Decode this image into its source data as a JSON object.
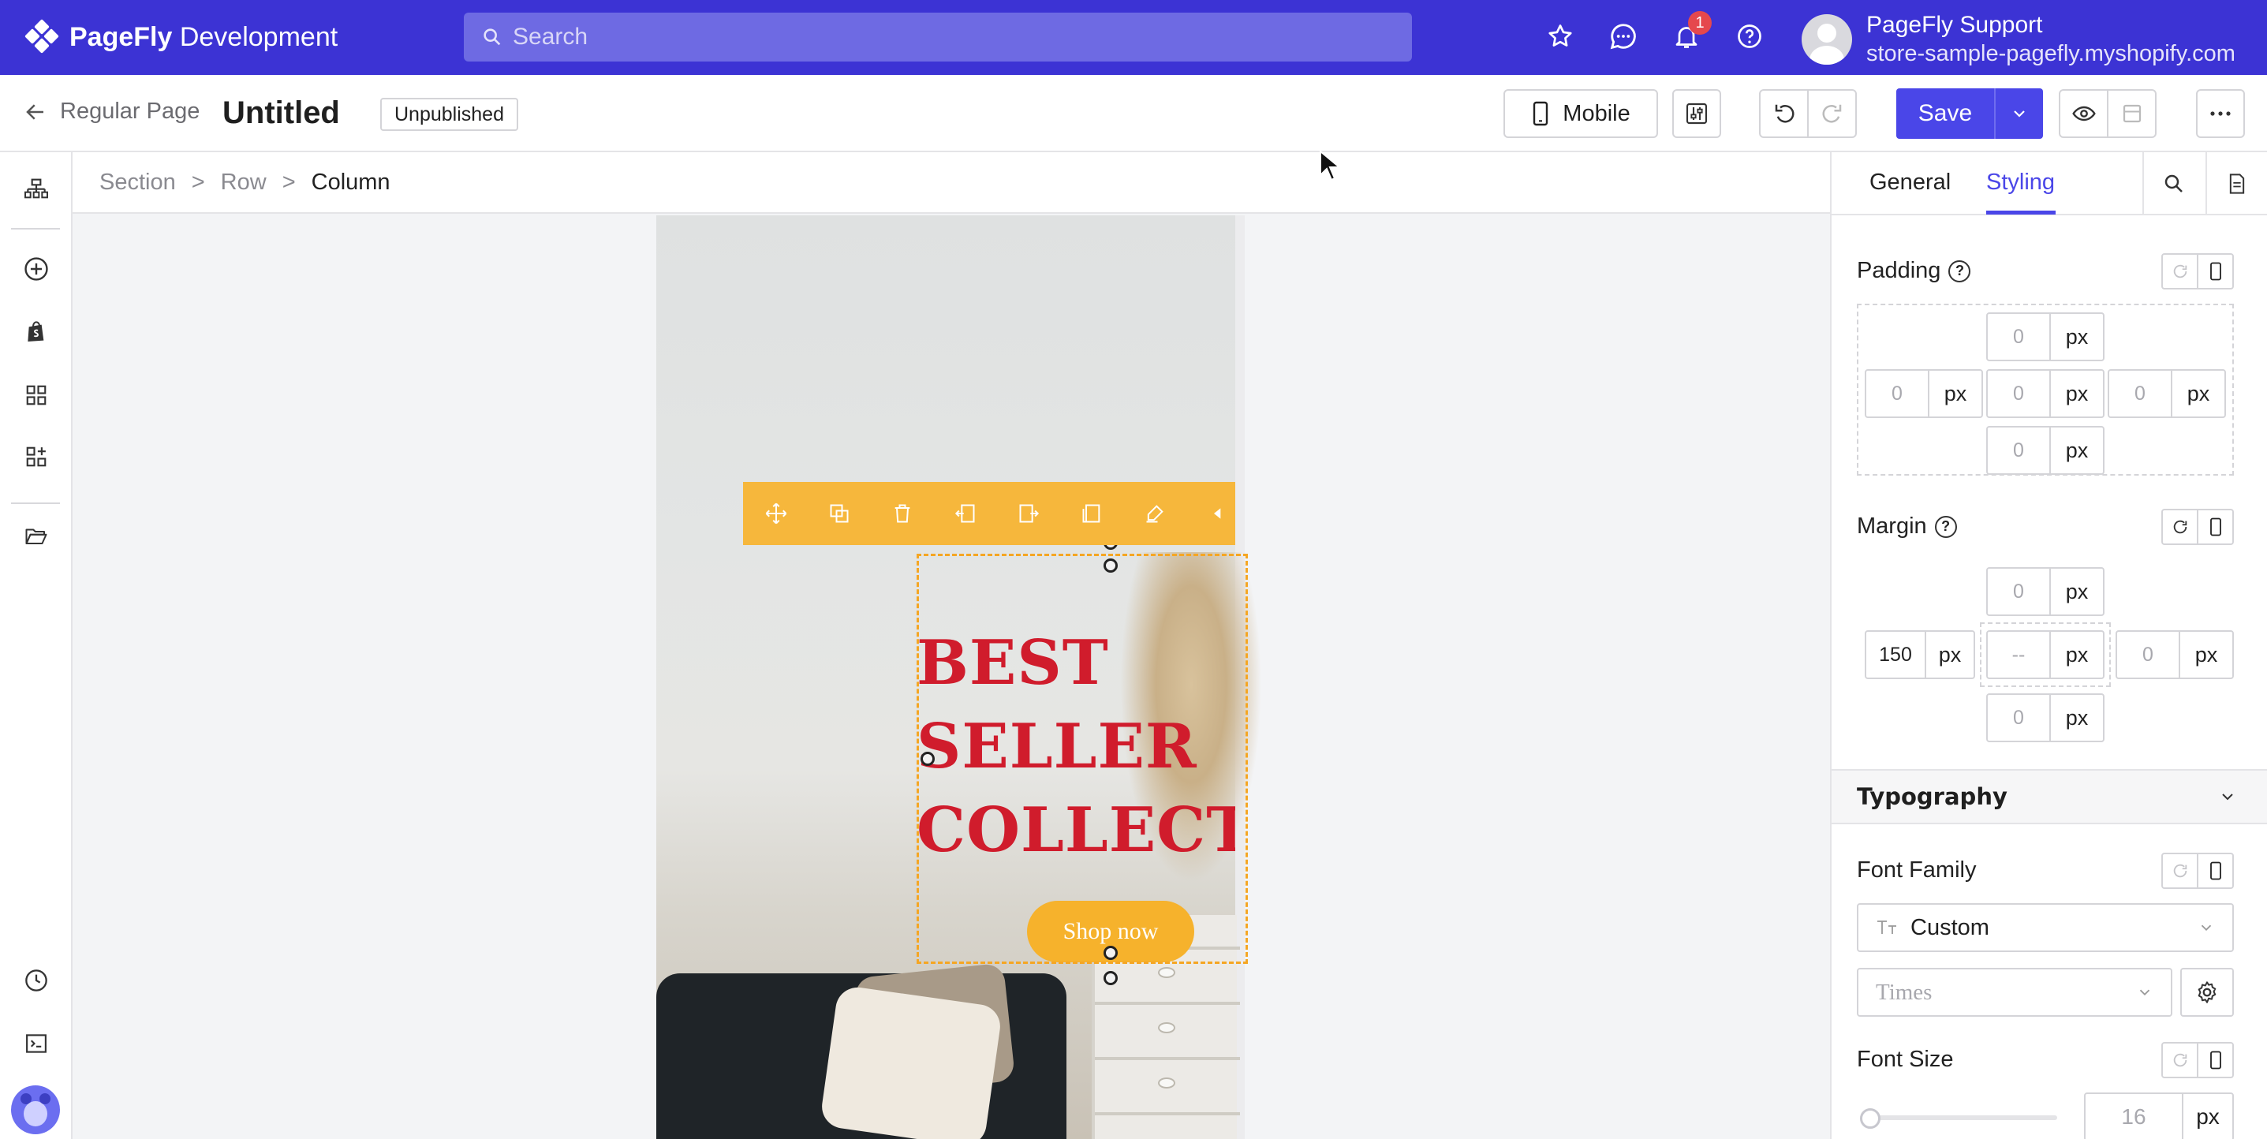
{
  "app": {
    "logo_bold": "PageFly",
    "logo_rest": " Development",
    "search_placeholder": "Search",
    "notification_count": "1",
    "user_name": "PageFly Support",
    "user_store": "store-sample-pagefly.myshopify.com"
  },
  "toolbar": {
    "back_label": "Regular Page",
    "page_title": "Untitled",
    "status": "Unpublished",
    "device_label": "Mobile",
    "save_label": "Save"
  },
  "breadcrumb": [
    "Section",
    "Row",
    "Column"
  ],
  "canvas": {
    "headline": "BEST\nSELLER\nCOLLECTION",
    "button_label": "Shop now"
  },
  "panel": {
    "tabs": [
      "General",
      "Styling"
    ],
    "active_tab": "Styling",
    "padding_label": "Padding",
    "padding": {
      "top": "0",
      "left": "0",
      "center": "0",
      "right": "0",
      "bottom": "0",
      "unit": "px"
    },
    "margin_label": "Margin",
    "margin": {
      "top": "0",
      "left": "150",
      "center": "--",
      "right": "0",
      "bottom": "0",
      "unit": "px"
    },
    "typography_label": "Typography",
    "font_family_label": "Font Family",
    "font_family_value": "Custom",
    "font_name_placeholder": "Times",
    "font_size_label": "Font Size",
    "font_size_placeholder": "16",
    "font_size_unit": "px"
  },
  "colors": {
    "brand": "#3c33d4",
    "accent": "#4a46e8",
    "headline": "#d01c2c",
    "selection": "#f5a623",
    "button": "#f6b22c"
  }
}
